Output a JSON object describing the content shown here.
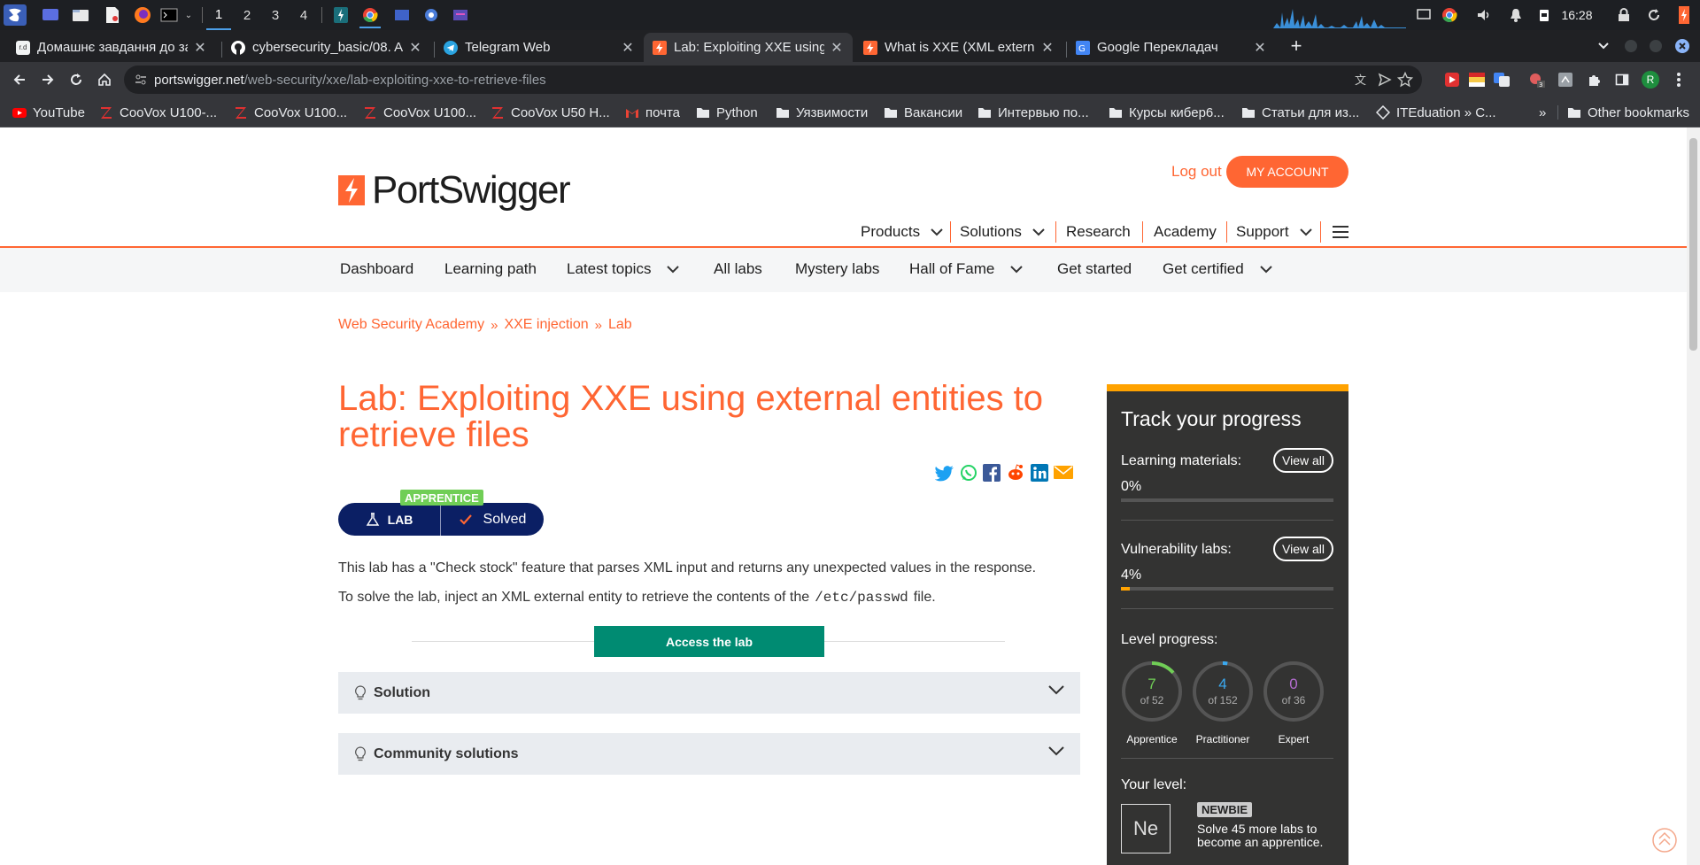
{
  "taskbar": {
    "workspaces": [
      "1",
      "2",
      "3",
      "4"
    ],
    "clock": "16:28"
  },
  "tabs": [
    {
      "title": "Домашнє завдання до за",
      "fav_color": "#f1f3f4",
      "fav_text": "r.d"
    },
    {
      "title": "cybersecurity_basic/08. A",
      "fav_color": "#ffffff",
      "fav_text": ""
    },
    {
      "title": "Telegram Web",
      "fav_color": "#2aa3e0",
      "fav_text": ""
    },
    {
      "title": "Lab: Exploiting XXE using",
      "fav_color": "#ff6633",
      "fav_text": ""
    },
    {
      "title": "What is XXE (XML externa",
      "fav_color": "#ff6633",
      "fav_text": ""
    },
    {
      "title": "Google Перекладач",
      "fav_color": "#4285f4",
      "fav_text": ""
    }
  ],
  "omnibox": {
    "host": "portswigger.net",
    "path": "/web-security/xxe/lab-exploiting-xxe-to-retrieve-files"
  },
  "profile_initial": "R",
  "bookmarks": [
    {
      "label": "YouTube",
      "icon": "youtube-icon"
    },
    {
      "label": "CooVox U100-...",
      "icon": "z-icon"
    },
    {
      "label": "CooVox U100...",
      "icon": "z-icon"
    },
    {
      "label": "CooVox U100...",
      "icon": "z-icon"
    },
    {
      "label": "CooVox U50 H...",
      "icon": "z-icon"
    },
    {
      "label": "почта",
      "icon": "gmail-icon"
    },
    {
      "label": "Python",
      "icon": "folder-icon"
    },
    {
      "label": "Уязвимости",
      "icon": "folder-icon"
    },
    {
      "label": "Вакансии",
      "icon": "folder-icon"
    },
    {
      "label": "Интервью по...",
      "icon": "folder-icon"
    },
    {
      "label": "Курсы кибер6...",
      "icon": "folder-icon"
    },
    {
      "label": "Статьи для из...",
      "icon": "folder-icon"
    },
    {
      "label": "ITEduation » C...",
      "icon": "itedu-icon"
    }
  ],
  "other_bookmarks": "Other bookmarks",
  "more_bookmarks": "»",
  "site": {
    "logo": "PortSwigger",
    "logout": "Log out",
    "my_account": "MY ACCOUNT",
    "main_nav": [
      "Products",
      "Solutions",
      "Research",
      "Academy",
      "Support"
    ],
    "sub_nav": [
      "Dashboard",
      "Learning path",
      "Latest topics",
      "All labs",
      "Mystery labs",
      "Hall of Fame",
      "Get started",
      "Get certified"
    ]
  },
  "breadcrumb": [
    "Web Security Academy",
    "XXE injection",
    "Lab"
  ],
  "breadcrumb_sep": "»",
  "lab": {
    "title": "Lab: Exploiting XXE using external entities to retrieve files",
    "level_badge": "APPRENTICE",
    "lab_label": "LAB",
    "status": "Solved",
    "desc1": "This lab has a \"Check stock\" feature that parses XML input and returns any unexpected values in the response.",
    "desc2_before": "To solve the lab, inject an XML external entity to retrieve the contents of the",
    "desc2_code": "/etc/passwd",
    "desc2_after": "file.",
    "access_button": "Access the lab",
    "solution": "Solution",
    "community": "Community solutions"
  },
  "progress": {
    "title": "Track your progress",
    "learning_label": "Learning materials:",
    "learning_pct": "0%",
    "learning_value": 0,
    "vuln_label": "Vulnerability labs:",
    "vuln_pct": "4%",
    "vuln_value": 4,
    "view_all": "View all",
    "level_label": "Level progress:",
    "rings": [
      {
        "value": "7",
        "total": "of 52",
        "name": "Apprentice",
        "color": "#70ce56",
        "done": 7,
        "max": 52
      },
      {
        "value": "4",
        "total": "of 152",
        "name": "Practitioner",
        "color": "#3aa9f0",
        "done": 4,
        "max": 152
      },
      {
        "value": "0",
        "total": "of 36",
        "name": "Expert",
        "color": "#b36ccf",
        "done": 0,
        "max": 36
      }
    ],
    "your_level": "Your level:",
    "level_symbol": "Ne",
    "level_name": "NEWBIE",
    "level_text": "Solve 45 more labs to become an apprentice."
  },
  "colors": {
    "accent": "#ff6633",
    "navy": "#0b1f64",
    "green": "#008b72",
    "apprentice": "#70ce56"
  }
}
